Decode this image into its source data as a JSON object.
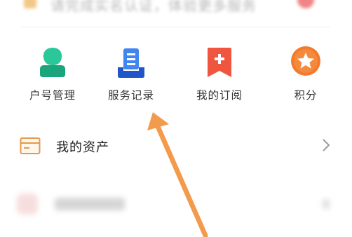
{
  "banner": {
    "text": "请完成实名认证，体验更多服务"
  },
  "quick_actions": [
    {
      "label": "户号管理",
      "icon": "account-management-icon",
      "color": "#1dbb8e"
    },
    {
      "label": "服务记录",
      "icon": "service-record-icon",
      "color": "#2f6fe0"
    },
    {
      "label": "我的订阅",
      "icon": "subscription-icon",
      "color": "#ee4b36"
    },
    {
      "label": "积分",
      "icon": "points-star-icon",
      "color": "#f37a2c"
    }
  ],
  "assets": {
    "label": "我的资产",
    "icon": "wallet-card-icon"
  },
  "annotation": {
    "color": "#f39a4c"
  }
}
